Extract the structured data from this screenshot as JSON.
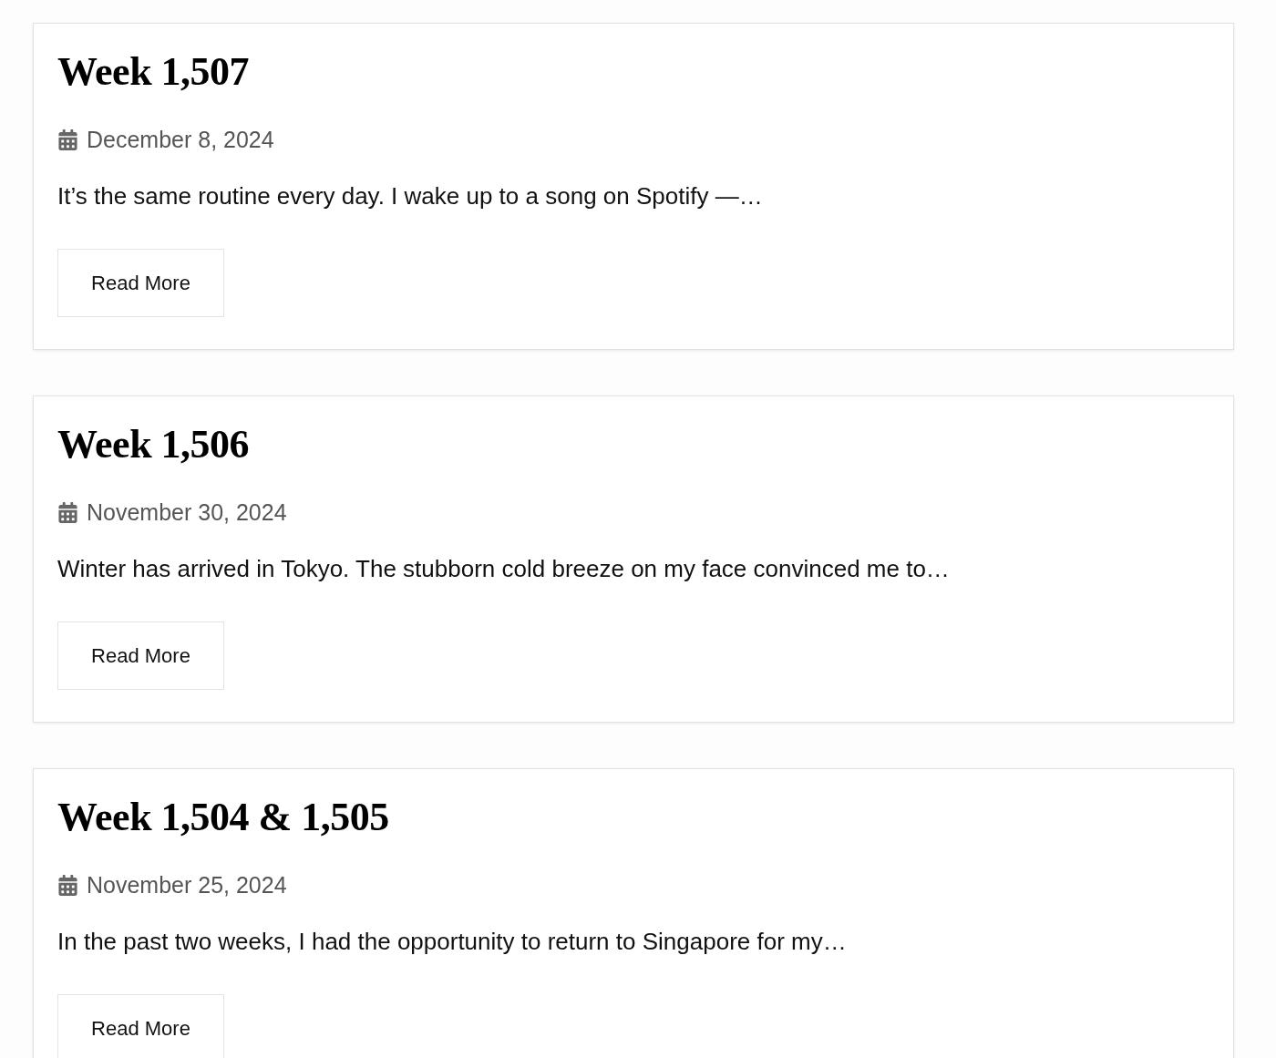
{
  "posts": [
    {
      "title": "Week 1,507",
      "date": "December 8, 2024",
      "excerpt": "It’s the same routine every day. I wake up to a song on Spotify —…",
      "button": "Read More"
    },
    {
      "title": "Week 1,506",
      "date": "November 30, 2024",
      "excerpt": "Winter has arrived in Tokyo. The stubborn cold breeze on my face convinced me to…",
      "button": "Read More"
    },
    {
      "title": "Week 1,504 & 1,505",
      "date": "November 25, 2024",
      "excerpt": "In the past two weeks, I had the opportunity to return to Singapore for my…",
      "button": "Read More"
    }
  ]
}
